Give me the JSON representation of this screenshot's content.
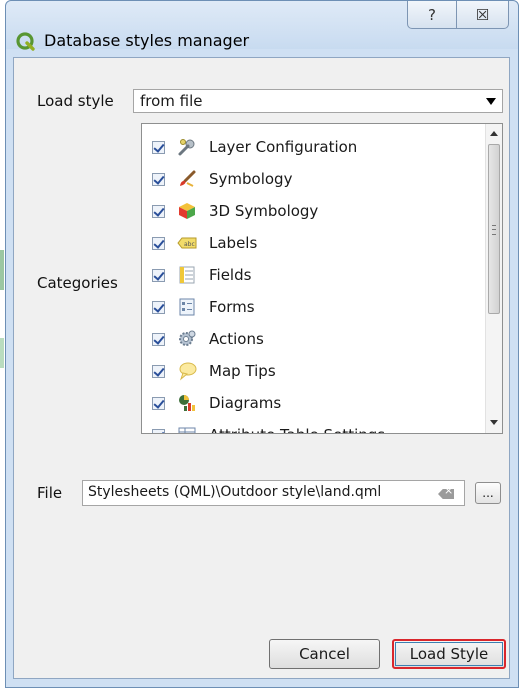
{
  "window": {
    "title": "Database styles manager",
    "help_glyph": "?",
    "close_glyph": "☒"
  },
  "load_style": {
    "label": "Load style",
    "selected": "from file"
  },
  "categories": {
    "label": "Categories",
    "items": [
      {
        "label": "Layer Configuration",
        "icon": "wrench-icon",
        "checked": true
      },
      {
        "label": "Symbology",
        "icon": "paintbrush-icon",
        "checked": true
      },
      {
        "label": "3D Symbology",
        "icon": "cube-icon",
        "checked": true
      },
      {
        "label": "Labels",
        "icon": "label-icon",
        "checked": true
      },
      {
        "label": "Fields",
        "icon": "fields-icon",
        "checked": true
      },
      {
        "label": "Forms",
        "icon": "form-icon",
        "checked": true
      },
      {
        "label": "Actions",
        "icon": "gear-icon",
        "checked": true
      },
      {
        "label": "Map Tips",
        "icon": "speech-bubble-icon",
        "checked": true
      },
      {
        "label": "Diagrams",
        "icon": "diagram-icon",
        "checked": true
      },
      {
        "label": "Attribute Table Settings",
        "icon": "table-icon",
        "checked": true
      }
    ]
  },
  "file": {
    "label": "File",
    "value": "Stylesheets (QML)\\Outdoor style\\land.qml",
    "browse_label": "..."
  },
  "buttons": {
    "cancel": "Cancel",
    "load": "Load Style"
  },
  "colors": {
    "accent_border": "#d9262c",
    "titlebar": "#cfe0f3"
  }
}
